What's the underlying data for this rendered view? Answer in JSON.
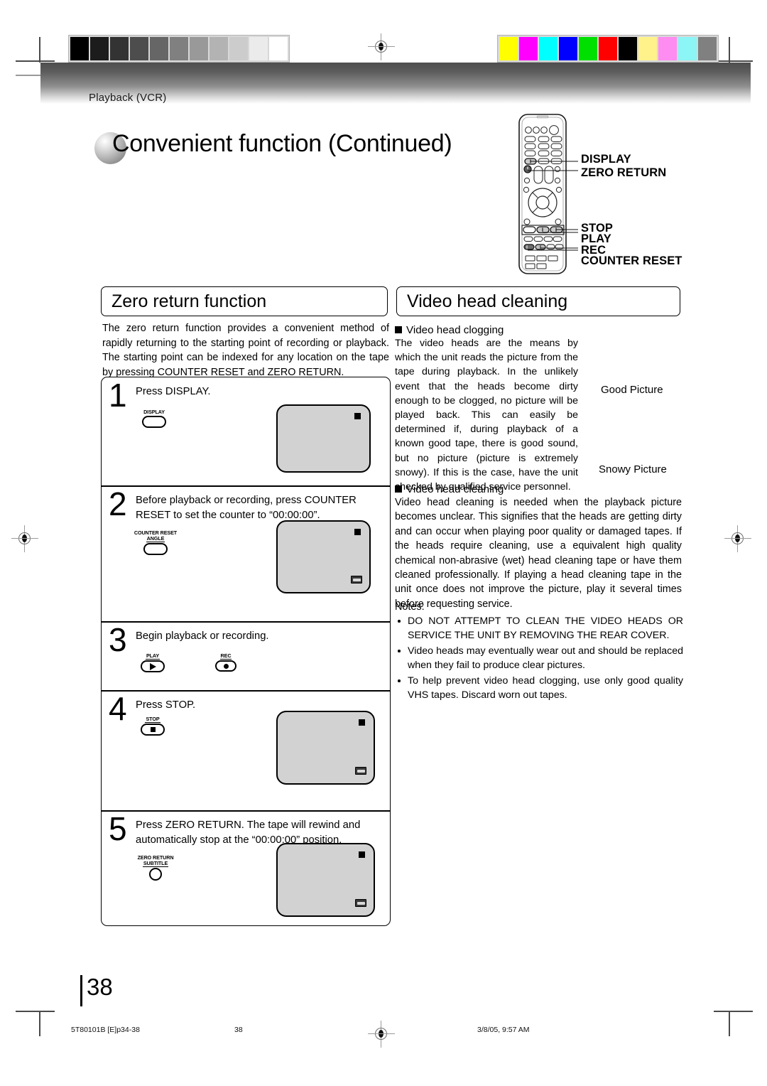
{
  "document": {
    "breadcrumb": "Playback (VCR)",
    "title": "Convenient function (Continued)",
    "page_number": "38"
  },
  "remote": {
    "labels": [
      {
        "name": "display",
        "text": "DISPLAY"
      },
      {
        "name": "zero-return",
        "text": "ZERO RETURN"
      },
      {
        "name": "stop",
        "text": "STOP"
      },
      {
        "name": "play",
        "text": "PLAY"
      },
      {
        "name": "rec",
        "text": "REC"
      },
      {
        "name": "counter-reset",
        "text": "COUNTER RESET"
      }
    ]
  },
  "left_column": {
    "heading": "Zero return function",
    "intro": "The zero return function provides a convenient method of rapidly returning to the starting point of recording or playback. The starting point can be indexed for any location on the tape by pressing COUNTER RESET and ZERO RETURN.",
    "steps": [
      {
        "number": "1",
        "text": "Press DISPLAY.",
        "key_caption_top": "",
        "key_caption": "DISPLAY",
        "key_shape": "oval",
        "key_glyph": "none"
      },
      {
        "number": "2",
        "text": "Before playback or recording, press COUNTER RESET to set the counter to “00:00:00”.",
        "key_caption_top": "COUNTER RESET",
        "key_caption": "ANGLE",
        "key_shape": "oval",
        "key_glyph": "none"
      },
      {
        "number": "3",
        "text": "Begin playback or recording.",
        "key_caption_top": "",
        "key_caption": "PLAY",
        "key_shape": "oval",
        "key_glyph": "triangle",
        "key2_caption": "REC",
        "key2_shape": "small-oval",
        "key2_glyph": "circle"
      },
      {
        "number": "4",
        "text": "Press STOP.",
        "key_caption_top": "",
        "key_caption": "STOP",
        "key_shape": "oval",
        "key_glyph": "square"
      },
      {
        "number": "5",
        "text": "Press ZERO RETURN. The tape will rewind and automatically stop at the “00:00:00” position.",
        "key_caption_top": "ZERO RETURN",
        "key_caption": "SUBTITLE",
        "key_shape": "circle",
        "key_glyph": "none"
      }
    ]
  },
  "right_column": {
    "heading": "Video head cleaning",
    "clogging_subhead": "Video head clogging",
    "clogging_body": "The video heads are the means by which the unit reads the picture from the tape during playback. In the unlikely event that the heads become dirty enough to be clogged, no picture will be played back. This can easily be determined if, during playback of a known good tape, there is good sound, but no picture (picture is extremely snowy). If this is the case, have the unit checked by qualified service personnel.",
    "good_picture_caption": "Good Picture",
    "snowy_picture_caption": "Snowy Picture",
    "cleaning_subhead": "Video head cleaning",
    "cleaning_body": "Video head cleaning is needed when the playback picture becomes unclear. This signifies that the heads are getting dirty and can occur when playing poor quality or damaged tapes. If the heads require cleaning, use a equivalent high quality chemical non-abrasive (wet) head cleaning tape or have them cleaned professionally. If playing a head cleaning tape in the unit once does not improve the picture, play it several times before requesting service.",
    "notes_label": "Notes:",
    "notes": [
      "DO NOT ATTEMPT TO CLEAN THE VIDEO HEADS OR SERVICE THE UNIT BY REMOVING THE REAR COVER.",
      "Video heads may eventually wear out and should be replaced when they fail to produce clear pictures.",
      "To help prevent video head clogging, use only good quality VHS tapes. Discard worn out tapes."
    ]
  },
  "footer": {
    "job_code": "5T80101B [E]p34-38",
    "page": "38",
    "timestamp": "3/8/05, 9:57 AM"
  },
  "print_bars": {
    "grayscale": [
      "#000000",
      "#1c1c1c",
      "#333333",
      "#4d4d4d",
      "#666666",
      "#808080",
      "#999999",
      "#b3b3b3",
      "#cccccc",
      "#ebebeb",
      "#ffffff"
    ],
    "color": [
      "#ffff00",
      "#ff00ff",
      "#00ffff",
      "#0000ff",
      "#00e000",
      "#ff0000",
      "#000000",
      "#fff28a",
      "#ff8cf0",
      "#8cf5f5",
      "#808080"
    ]
  }
}
